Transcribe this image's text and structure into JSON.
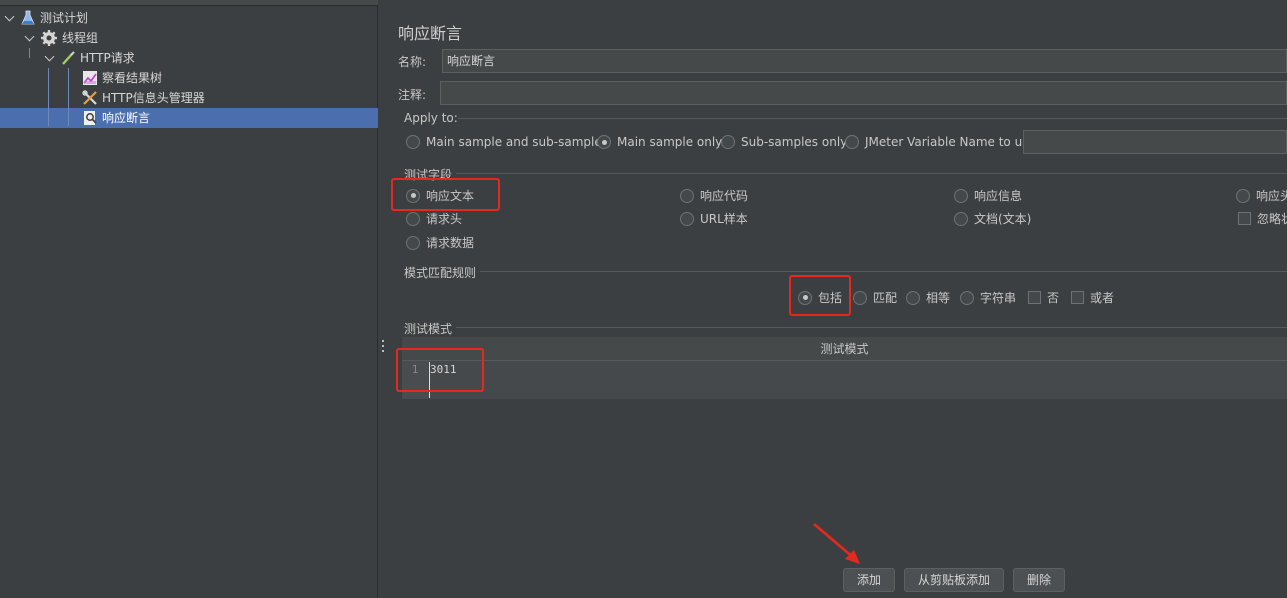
{
  "tree": {
    "items": [
      {
        "label": "测试计划",
        "icon": "flask-icon"
      },
      {
        "label": "线程组",
        "icon": "gear-icon"
      },
      {
        "label": "HTTP请求",
        "icon": "pipette-icon"
      },
      {
        "label": "察看结果树",
        "icon": "chart-icon"
      },
      {
        "label": "HTTP信息头管理器",
        "icon": "tools-icon"
      },
      {
        "label": "响应断言",
        "icon": "assertion-icon"
      }
    ],
    "selected_index": 5
  },
  "panel": {
    "title": "响应断言",
    "name_label": "名称:",
    "name_value": "响应断言",
    "comment_label": "注释:",
    "comment_value": "",
    "apply_to": {
      "label": "Apply to:",
      "options": [
        "Main sample and sub-samples",
        "Main sample only",
        "Sub-samples only",
        "JMeter Variable Name to use"
      ],
      "selected": "Main sample only",
      "variable_value": ""
    },
    "test_field": {
      "label": "测试字段",
      "options": [
        "响应文本",
        "响应代码",
        "响应信息",
        "响应头",
        "请求头",
        "URL样本",
        "文档(文本)",
        "忽略状态",
        "请求数据"
      ],
      "selected": "响应文本"
    },
    "pattern_rules": {
      "label": "模式匹配规则",
      "radios": [
        "包括",
        "匹配",
        "相等",
        "字符串"
      ],
      "selected": "包括",
      "checkboxes": [
        "否",
        "或者"
      ]
    },
    "test_patterns": {
      "label": "测试模式",
      "column_header": "测试模式",
      "line_number": "1",
      "value": "3011"
    },
    "buttons": {
      "add": "添加",
      "add_from_clipboard": "从剪贴板添加",
      "delete": "删除"
    }
  },
  "colors": {
    "background": "#3c3f41",
    "selection": "#4b6eaf",
    "highlight_annotation": "#e8281e"
  }
}
